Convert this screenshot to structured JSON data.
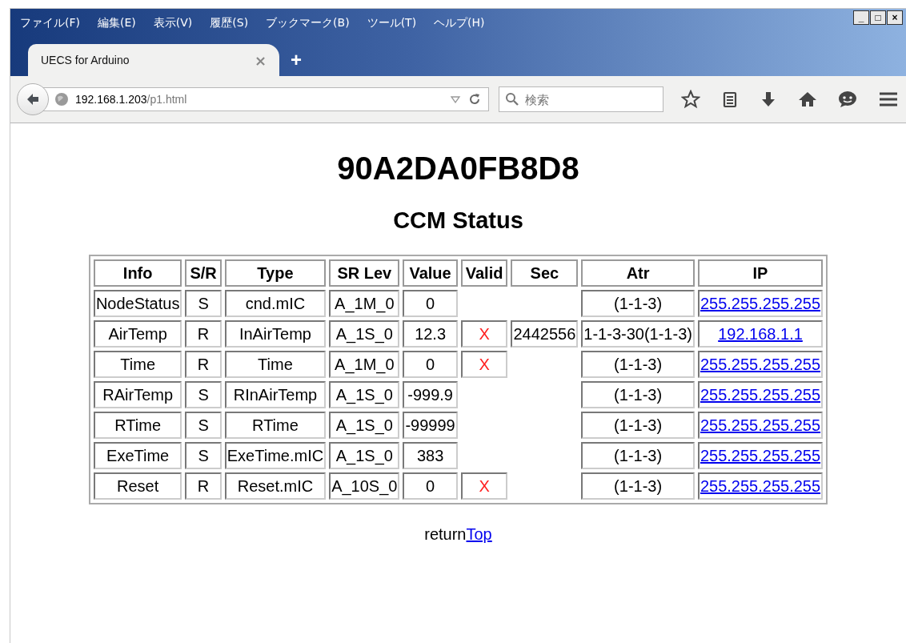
{
  "menu": [
    "ファイル(F)",
    "編集(E)",
    "表示(V)",
    "履歴(S)",
    "ブックマーク(B)",
    "ツール(T)",
    "ヘルプ(H)"
  ],
  "window_controls": [
    "_",
    "□",
    "×"
  ],
  "tabs": [
    {
      "label": "UECS for Arduino",
      "selected": true,
      "close": "×"
    }
  ],
  "new_tab": "+",
  "address": {
    "host": "192.168.1.203",
    "path": "/p1.html"
  },
  "search": {
    "placeholder": "検索"
  },
  "page": {
    "title": "90A2DA0FB8D8",
    "subtitle": "CCM Status",
    "table": {
      "columns": [
        "Info",
        "S/R",
        "Type",
        "SR Lev",
        "Value",
        "Valid",
        "Sec",
        "Atr",
        "IP"
      ],
      "rows": [
        {
          "info": "NodeStatus",
          "sr": "S",
          "type": "cnd.mIC",
          "srlev": "A_1M_0",
          "value": "0",
          "atr": "(1-1-3)",
          "ip": "255.255.255.255"
        },
        {
          "info": "AirTemp",
          "sr": "R",
          "type": "InAirTemp",
          "srlev": "A_1S_0",
          "value": "12.3",
          "valid": "X",
          "sec": "2442556",
          "atr": "1-1-3-30(1-1-3)",
          "ip": "192.168.1.1"
        },
        {
          "info": "Time",
          "sr": "R",
          "type": "Time",
          "srlev": "A_1M_0",
          "value": "0",
          "valid": "X",
          "atr": "(1-1-3)",
          "ip": "255.255.255.255"
        },
        {
          "info": "RAirTemp",
          "sr": "S",
          "type": "RInAirTemp",
          "srlev": "A_1S_0",
          "value": "-999.9",
          "atr": "(1-1-3)",
          "ip": "255.255.255.255"
        },
        {
          "info": "RTime",
          "sr": "S",
          "type": "RTime",
          "srlev": "A_1S_0",
          "value": "-99999",
          "atr": "(1-1-3)",
          "ip": "255.255.255.255"
        },
        {
          "info": "ExeTime",
          "sr": "S",
          "type": "ExeTime.mIC",
          "srlev": "A_1S_0",
          "value": "383",
          "atr": "(1-1-3)",
          "ip": "255.255.255.255"
        },
        {
          "info": "Reset",
          "sr": "R",
          "type": "Reset.mIC",
          "srlev": "A_10S_0",
          "value": "0",
          "valid": "X",
          "atr": "(1-1-3)",
          "ip": "255.255.255.255"
        }
      ]
    },
    "return_text": "return",
    "return_link": "Top"
  }
}
